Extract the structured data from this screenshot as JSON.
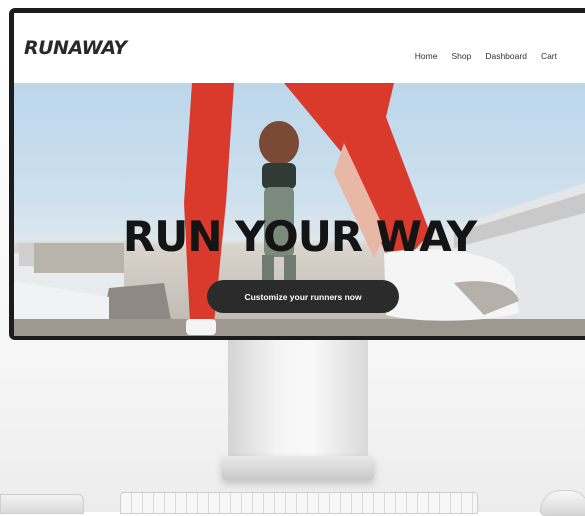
{
  "brand": {
    "logo_text": "RUNAWAY"
  },
  "nav": {
    "items": [
      "Home",
      "Shop",
      "Dashboard",
      "Cart"
    ]
  },
  "hero": {
    "headline": "RUN YOUR WAY",
    "cta_label": "Customize your runners now"
  },
  "colors": {
    "bezel": "#1c1c1c",
    "cta_bg": "#2b2b2b",
    "legging_red": "#d93a2c",
    "sky": "#cde0ee"
  }
}
